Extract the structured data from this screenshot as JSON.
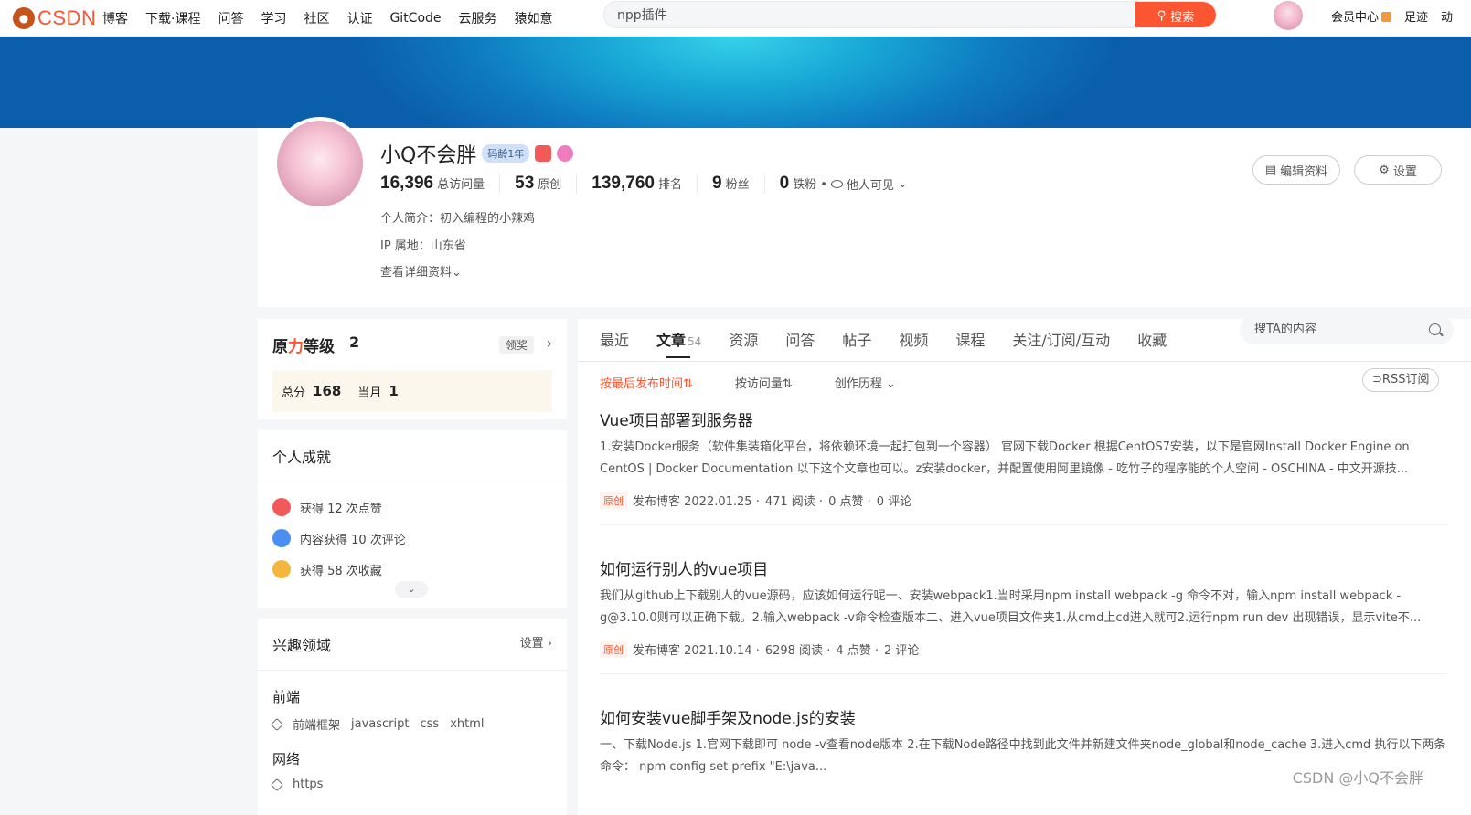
{
  "topbar": {
    "logo_text": "CSDN",
    "nav": [
      "博客",
      "下载·课程",
      "问答",
      "学习",
      "社区",
      "认证",
      "GitCode",
      "云服务",
      "猿如意"
    ],
    "search_value": "npp插件",
    "search_button": "搜索",
    "right_items": [
      "会员中心",
      "足迹",
      "动"
    ]
  },
  "profile": {
    "username": "小Q不会胖",
    "badge_age": "码龄1年",
    "stats": [
      {
        "value": "16,396",
        "label": "总访问量"
      },
      {
        "value": "53",
        "label": "原创"
      },
      {
        "value": "139,760",
        "label": "排名"
      },
      {
        "value": "9",
        "label": "粉丝"
      },
      {
        "value": "0",
        "label": "铁粉"
      }
    ],
    "visibility": "他人可见",
    "bio": "个人简介：初入编程的小辣鸡",
    "ip": "IP 属地：山东省",
    "more": "查看详细资料",
    "edit_button": "编辑资料",
    "settings_button": "设置"
  },
  "level": {
    "title_prefix": "原",
    "title_red": "力",
    "title_suffix": "等级",
    "level": "2",
    "claim": "领奖",
    "total_label": "总分",
    "total_value": "168",
    "month_label": "当月",
    "month_value": "1"
  },
  "achievements": {
    "title": "个人成就",
    "items": [
      "获得 12 次点赞",
      "内容获得 10 次评论",
      "获得 58 次收藏"
    ],
    "colors": [
      "#f25a5a",
      "#4a8ff0",
      "#f5b63d"
    ]
  },
  "interests": {
    "title": "兴趣领域",
    "settings": "设置",
    "groups": [
      {
        "name": "前端",
        "tags": [
          "前端框架",
          "javascript",
          "css",
          "xhtml"
        ]
      },
      {
        "name": "网络",
        "tags": [
          "https"
        ]
      }
    ]
  },
  "main": {
    "tabs": [
      "最近",
      "文章",
      "资源",
      "问答",
      "帖子",
      "视频",
      "课程",
      "关注/订阅/互动",
      "收藏"
    ],
    "article_count": "54",
    "search_placeholder": "搜TA的内容",
    "sorts": [
      "按最后发布时间⇅",
      "按访问量⇅",
      "创作历程"
    ],
    "rss": "RSS订阅",
    "articles": [
      {
        "title": "Vue项目部署到服务器",
        "desc": "1.安装Docker服务（软件集装箱化平台，将依赖环境一起打包到一个容器） 官网下载Docker 根据CentOS7安装，以下是官网Install Docker Engine on CentOS | Docker Documentation 以下这个文章也可以。z安装docker，并配置使用阿里镜像 - 吃竹子的程序能的个人空间 - OSCHINA - 中文开源技...",
        "tag": "原创",
        "date": "发布博客 2022.01.25 ·",
        "reads": "471 阅读 ·",
        "likes": "0 点赞 ·",
        "comments": "0 评论"
      },
      {
        "title": "如何运行别人的vue项目",
        "desc": "我们从github上下载别人的vue源码，应该如何运行呢一、安装webpack1.当时采用npm install webpack -g 命令不对，输入npm install webpack -g@3.10.0则可以正确下载。2.输入webpack -v命令检查版本二、进入vue项目文件夹1.从cmd上cd进入就可2.运行npm run dev 出现错误，显示vite不...",
        "tag": "原创",
        "date": "发布博客 2021.10.14 ·",
        "reads": "6298 阅读 ·",
        "likes": "4 点赞 ·",
        "comments": "2 评论"
      },
      {
        "title": "如何安装vue脚手架及node.js的安装",
        "desc": "一、下载Node.js 1.官网下载即可 node -v查看node版本 2.在下载Node路径中找到此文件并新建文件夹node_global和node_cache 3.进入cmd 执行以下两条命令： npm config set prefix \"E:\\java..."
      }
    ]
  },
  "watermark": "CSDN @小Q不会胖"
}
